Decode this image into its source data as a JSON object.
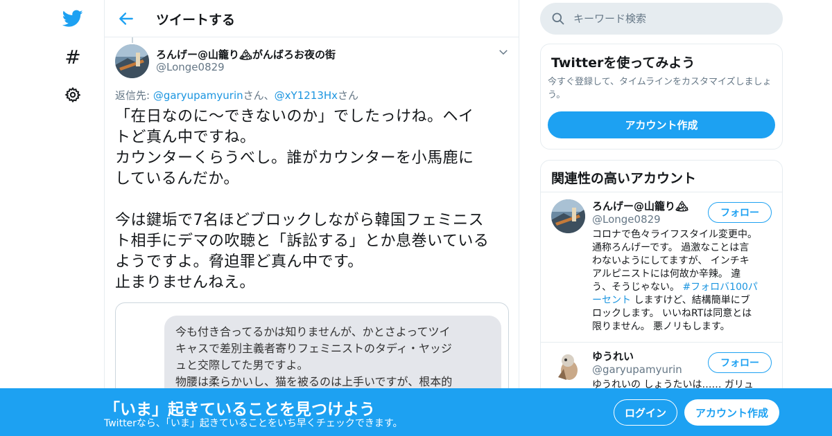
{
  "nav": {
    "icons": [
      "twitter-bird-icon",
      "hashtag-icon",
      "gear-icon"
    ]
  },
  "header": {
    "title": "ツイートする"
  },
  "tweet": {
    "author_name": "ろんげー@山籠り🏔がんばろお夜の街",
    "author_handle": "@Longe0829",
    "reply_prefix": "返信先: ",
    "reply_to_1": "@garyupamyurin",
    "reply_suffix_1": "さん、",
    "reply_to_2": "@xY1213Hx",
    "reply_suffix_2": "さん",
    "lines": [
      "「在日なのに～できないのか」でしたっけね。ヘイ",
      "トど真ん中ですね。",
      "カウンターくらうべし。誰がカウンターを小馬鹿に",
      "しているんだか。",
      "今は鍵垢で7名ほどブロックしながら韓国フェミニス",
      "ト相手にデマの吹聴と「訴訟する」とか息巻いている",
      "ようですよ。脅迫罪ど真ん中です。",
      "止まりませんねえ。"
    ],
    "media_text": [
      "今も付き合ってるかは知りませんが、かとさよってツイ",
      "キャスで差別主義者寄りフェミニストのタディ・ヤッジ",
      "ュと交際してた男ですよ。",
      "物腰は柔らかいし、猫を被るのは上手いですが、根本的"
    ]
  },
  "search": {
    "placeholder": "キーワード検索"
  },
  "try_card": {
    "title": "Twitterを使ってみよう",
    "description": "今すぐ登録して、タイムラインをカスタマイズしましょう。",
    "button": "アカウント作成"
  },
  "related": {
    "title": "関連性の高いアカウント",
    "accounts": [
      {
        "name": "ろんげー@山籠り🏔",
        "handle": "@Longe0829",
        "follow": "フォロー",
        "bio_lines": [
          "コロナで色々ライフスタイル変更中。",
          "通称ろんげーです。 過激なことは言",
          "わないようにしてますが、 インチキ",
          "アルピニストには何故か辛辣。 違",
          "う、そうじゃない。 ",
          "#フォロバ100パ",
          "ーセント",
          " しますけど、結構簡単にブ",
          "ロックします。 いいねRTは同意とは",
          "限りません。 悪ノリもします。"
        ]
      },
      {
        "name": "ゆうれい",
        "handle": "@garyupamyurin",
        "follow": "フォロー",
        "bio_lines": [
          "ゆうれいの しょうたいは…… ガリュ"
        ]
      }
    ]
  },
  "banner": {
    "title": "「いま」起きていることを見つけよう",
    "subtitle": "Twitterなら、「いま」起きていることをいち早くチェックできます。",
    "login": "ログイン",
    "signup": "アカウント作成"
  },
  "colors": {
    "brand": "#1da1f2",
    "link": "#1b95e0",
    "muted": "#657786",
    "border": "#e6ecf0"
  }
}
